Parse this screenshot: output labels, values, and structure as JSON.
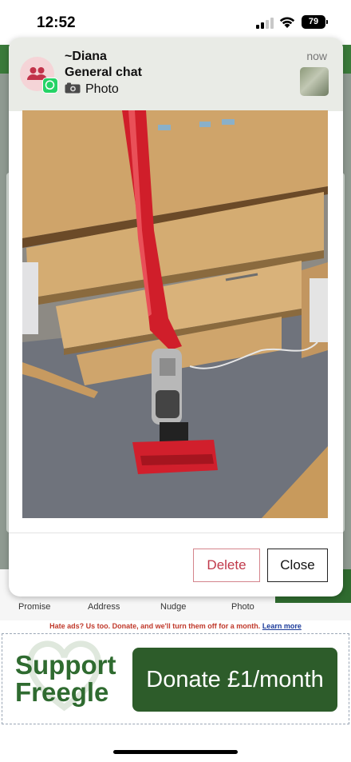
{
  "status_bar": {
    "time": "12:52",
    "battery": "79"
  },
  "notification": {
    "sender": "~Diana",
    "chat": "General chat",
    "message": "Photo",
    "time": "now"
  },
  "modal": {
    "delete_label": "Delete",
    "close_label": "Close"
  },
  "background_tabs": [
    "Promise",
    "Address",
    "Nudge",
    "Photo"
  ],
  "ad": {
    "note": "Hate ads? Us too. Donate, and we'll turn them off for a month.",
    "learn_more": "Learn more",
    "brand_line1": "Support",
    "brand_line2": "Freegle",
    "donate": "Donate  £1/month"
  },
  "colors": {
    "brand_green": "#2d5c2a",
    "delete_red": "#c0394a",
    "whatsapp": "#25d366"
  }
}
